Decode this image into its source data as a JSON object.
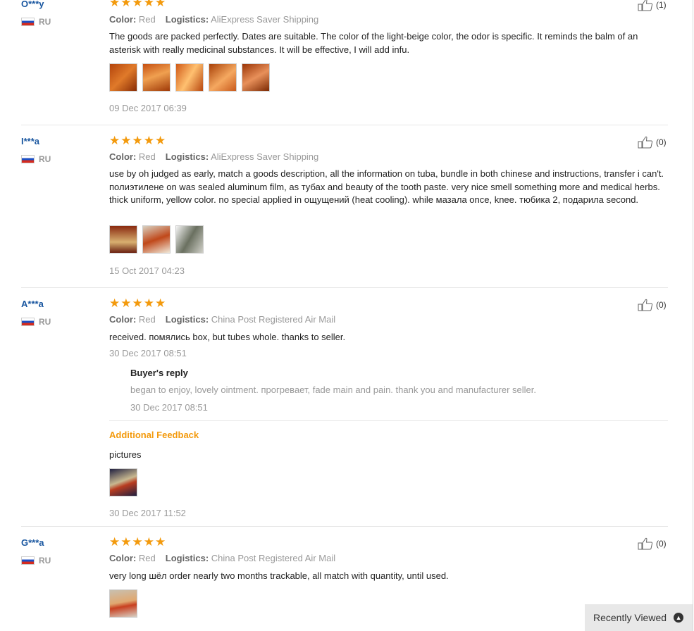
{
  "labels": {
    "color": "Color:",
    "logistics": "Logistics:",
    "buyers_reply": "Buyer's reply",
    "additional_feedback": "Additional Feedback"
  },
  "reviews": [
    {
      "user": "O***y",
      "country": "RU",
      "rating": 5,
      "likes": "(1)",
      "color": "Red",
      "logistics": "AliExpress Saver Shipping",
      "text": "The goods are packed perfectly. Dates are suitable. The color of the light-beige color, the odor is specific. It reminds the balm of an asterisk with really medicinal substances. It will be effective, I will add infu.",
      "photo_count": 5,
      "date": "09 Dec 2017 06:39"
    },
    {
      "user": "I***a",
      "country": "RU",
      "rating": 5,
      "likes": "(0)",
      "color": "Red",
      "logistics": "AliExpress Saver Shipping",
      "text": "use by oh judged as early, match a goods description, all the information on tuba, bundle in both chinese and instructions, transfer i can't. полиэтилене on was sealed aluminum film, as тубах and beauty of the tooth paste. very nice smell something more and medical herbs. thick uniform, yellow color. no special applied in ощущений (heat cooling). while мазала once, knee. тюбика 2, подарила second.",
      "photo_count": 3,
      "date": "15 Oct 2017 04:23"
    },
    {
      "user": "A***a",
      "country": "RU",
      "rating": 5,
      "likes": "(0)",
      "color": "Red",
      "logistics": "China Post Registered Air Mail",
      "text": "received. помялись box, but tubes whole. thanks to seller.",
      "date": "30 Dec 2017 08:51",
      "reply": {
        "text": "began to enjoy, lovely ointment. прогревает, fade main and pain. thank you and manufacturer seller.",
        "date": "30 Dec 2017 08:51"
      },
      "additional": {
        "text": "pictures",
        "photo_count": 1,
        "date": "30 Dec 2017 11:52"
      }
    },
    {
      "user": "G***a",
      "country": "RU",
      "rating": 5,
      "likes": "(0)",
      "color": "Red",
      "logistics": "China Post Registered Air Mail",
      "text": "very long шёл order nearly two months trackable, all match with quantity, until used.",
      "photo_count": 1
    }
  ],
  "recently_viewed": "Recently Viewed",
  "colors": {
    "accent": "#f39a0d",
    "user": "#1a57a0"
  }
}
